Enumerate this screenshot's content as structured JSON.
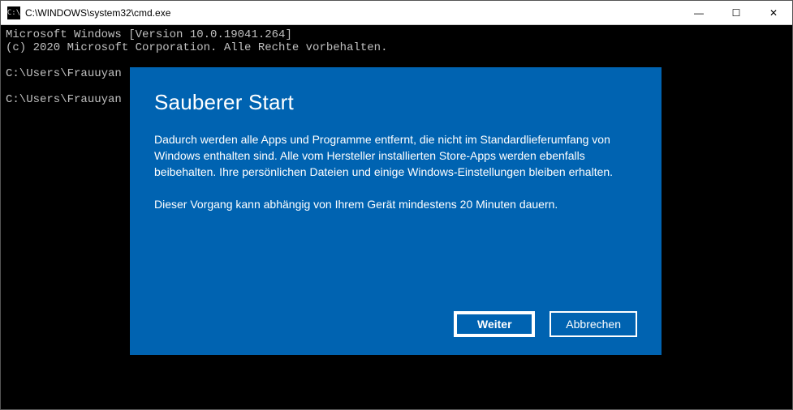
{
  "window": {
    "title": "C:\\WINDOWS\\system32\\cmd.exe",
    "icon_text": "C:\\",
    "min_glyph": "—",
    "max_glyph": "☐",
    "close_glyph": "✕"
  },
  "terminal": {
    "lines": [
      "Microsoft Windows [Version 10.0.19041.264]",
      "(c) 2020 Microsoft Corporation. Alle Rechte vorbehalten.",
      "",
      "C:\\Users\\Frauuyan",
      "",
      "C:\\Users\\Frauuyan"
    ]
  },
  "dialog": {
    "title": "Sauberer Start",
    "paragraph1": "Dadurch werden alle Apps und Programme entfernt, die nicht im Standardlieferumfang von Windows enthalten sind. Alle vom Hersteller installierten Store-Apps werden ebenfalls beibehalten. Ihre persönlichen Dateien und einige Windows-Einstellungen bleiben erhalten.",
    "paragraph2": "Dieser Vorgang kann abhängig von Ihrem Gerät mindestens 20 Minuten dauern.",
    "primary_button": "Weiter",
    "secondary_button": "Abbrechen"
  },
  "colors": {
    "dialog_bg": "#0063b1",
    "terminal_fg": "#c0c0c0"
  }
}
